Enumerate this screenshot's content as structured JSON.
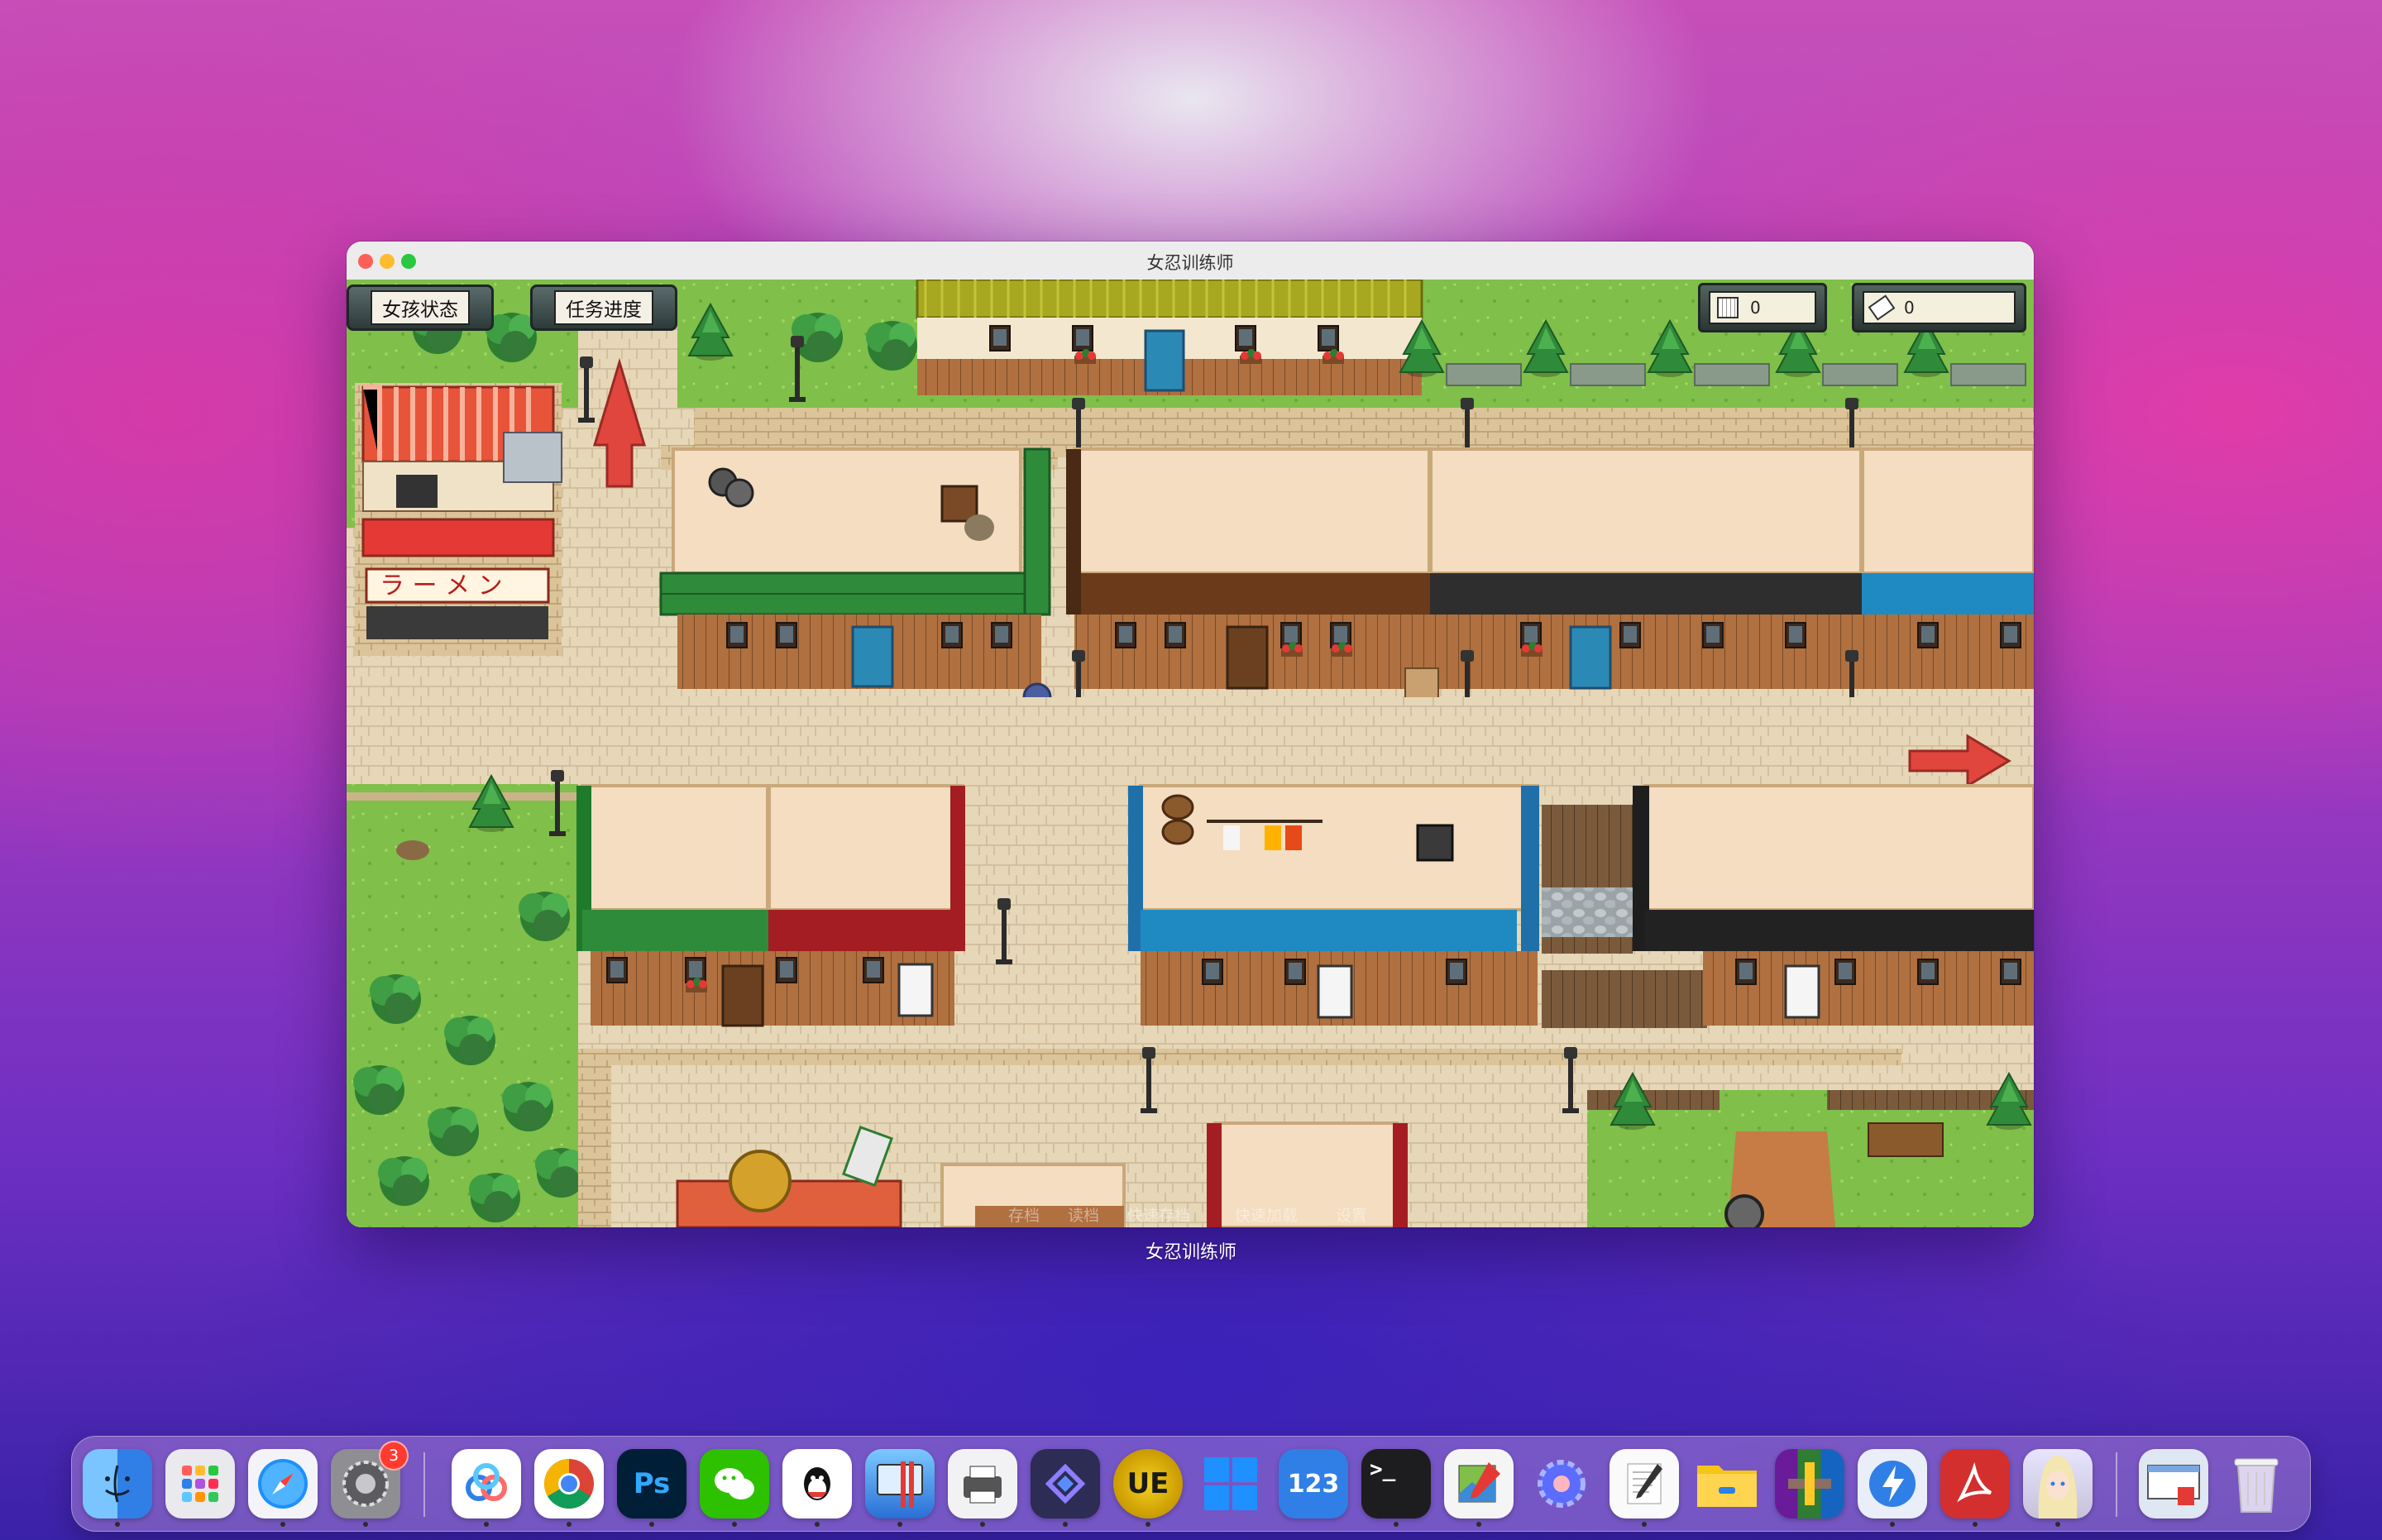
{
  "window": {
    "title": "女忍训练师",
    "caption": "女忍训练师"
  },
  "hud": {
    "girl_status_label": "女孩状态",
    "quest_progress_label": "任务进度",
    "day_count": "0",
    "ticket_count": "0"
  },
  "game": {
    "ramen_sign": "ラ ー メ ン",
    "menu_items": [
      "存档",
      "读档",
      "快速存档",
      "快速加载",
      "设置"
    ]
  },
  "dock": {
    "finder_badge": "",
    "settings_badge": "3",
    "items": [
      {
        "name": "Finder",
        "icon": "finder-icon"
      },
      {
        "name": "Launchpad",
        "icon": "launchpad-icon"
      },
      {
        "name": "Safari",
        "icon": "safari-icon"
      },
      {
        "name": "System Preferences",
        "icon": "gear-icon"
      },
      {
        "name": "Baidu Netdisk",
        "icon": "netdisk-icon"
      },
      {
        "name": "Chrome",
        "icon": "chrome-icon"
      },
      {
        "name": "Photoshop",
        "icon": "photoshop-icon",
        "label": "Ps"
      },
      {
        "name": "WeChat",
        "icon": "wechat-icon"
      },
      {
        "name": "QQ",
        "icon": "qq-icon"
      },
      {
        "name": "Parallels",
        "icon": "parallels-icon"
      },
      {
        "name": "Printer",
        "icon": "printer-icon"
      },
      {
        "name": "Shortcut App",
        "icon": "diamond-app-icon"
      },
      {
        "name": "UltraEdit",
        "icon": "ultraedit-icon",
        "label": "UE"
      },
      {
        "name": "Windows App",
        "icon": "windows-icon"
      },
      {
        "name": "Numbers",
        "icon": "numbers-icon",
        "label": "123"
      },
      {
        "name": "Terminal",
        "icon": "terminal-icon",
        "label": ">_"
      },
      {
        "name": "Preview",
        "icon": "preview-icon"
      },
      {
        "name": "Gear Tool",
        "icon": "cog-tool-icon"
      },
      {
        "name": "TextEdit",
        "icon": "textedit-icon"
      },
      {
        "name": "Folder",
        "icon": "folder-icon"
      },
      {
        "name": "RAR",
        "icon": "rar-icon"
      },
      {
        "name": "Speed App",
        "icon": "lightning-icon"
      },
      {
        "name": "Acrobat",
        "icon": "acrobat-icon"
      },
      {
        "name": "Avatar App",
        "icon": "avatar-icon"
      },
      {
        "name": "Screen Window",
        "icon": "window-preview-icon"
      },
      {
        "name": "Trash",
        "icon": "trash-icon"
      }
    ]
  }
}
